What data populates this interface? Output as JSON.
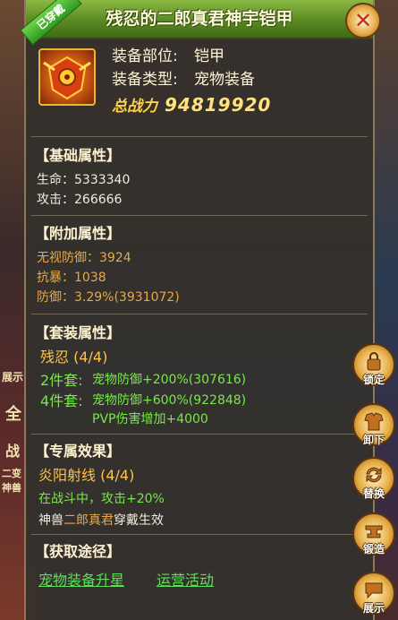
{
  "title": "残忍的二郎真君神宇铠甲",
  "equipped_badge": "已穿戴",
  "item": {
    "part_label": "装备部位:",
    "part_value": "铠甲",
    "type_label": "装备类型:",
    "type_value": "宠物装备",
    "power_label": "总战力",
    "power_value": "94819920"
  },
  "base": {
    "header": "【基础属性】",
    "lines": [
      "生命：5333340",
      "攻击：266666"
    ]
  },
  "extra": {
    "header": "【附加属性】",
    "lines": [
      "无视防御：3924",
      "抗暴：1038",
      "防御：3.29%(3931072)"
    ]
  },
  "set": {
    "header": "【套装属性】",
    "name": "残忍 (4/4)",
    "two_label": "2件套:",
    "two_value": "宠物防御+200%(307616)",
    "four_label": "4件套:",
    "four_value": "宠物防御+600%(922848)",
    "four_value2": "PVP伤害增加+4000"
  },
  "exclusive": {
    "header": "【专属效果】",
    "name": "炎阳射线 (4/4)",
    "effect": "在战斗中，攻击+20%",
    "note_a": "神兽",
    "note_b": "二郎真君",
    "note_c": "穿戴生效"
  },
  "source": {
    "header": "【获取途径】",
    "links": [
      "宠物装备升星",
      "运营活动"
    ]
  },
  "side_buttons": [
    "锁定",
    "卸下",
    "替换",
    "锻造",
    "展示"
  ],
  "bg_labels": [
    "展示",
    "全",
    "战",
    "二变神兽"
  ],
  "colors": {
    "title_green": "#5b8a23",
    "power_gold": "#ffd24a",
    "orange_text": "#e8a848",
    "green_text": "#78e848",
    "link_green": "#5be05a"
  }
}
